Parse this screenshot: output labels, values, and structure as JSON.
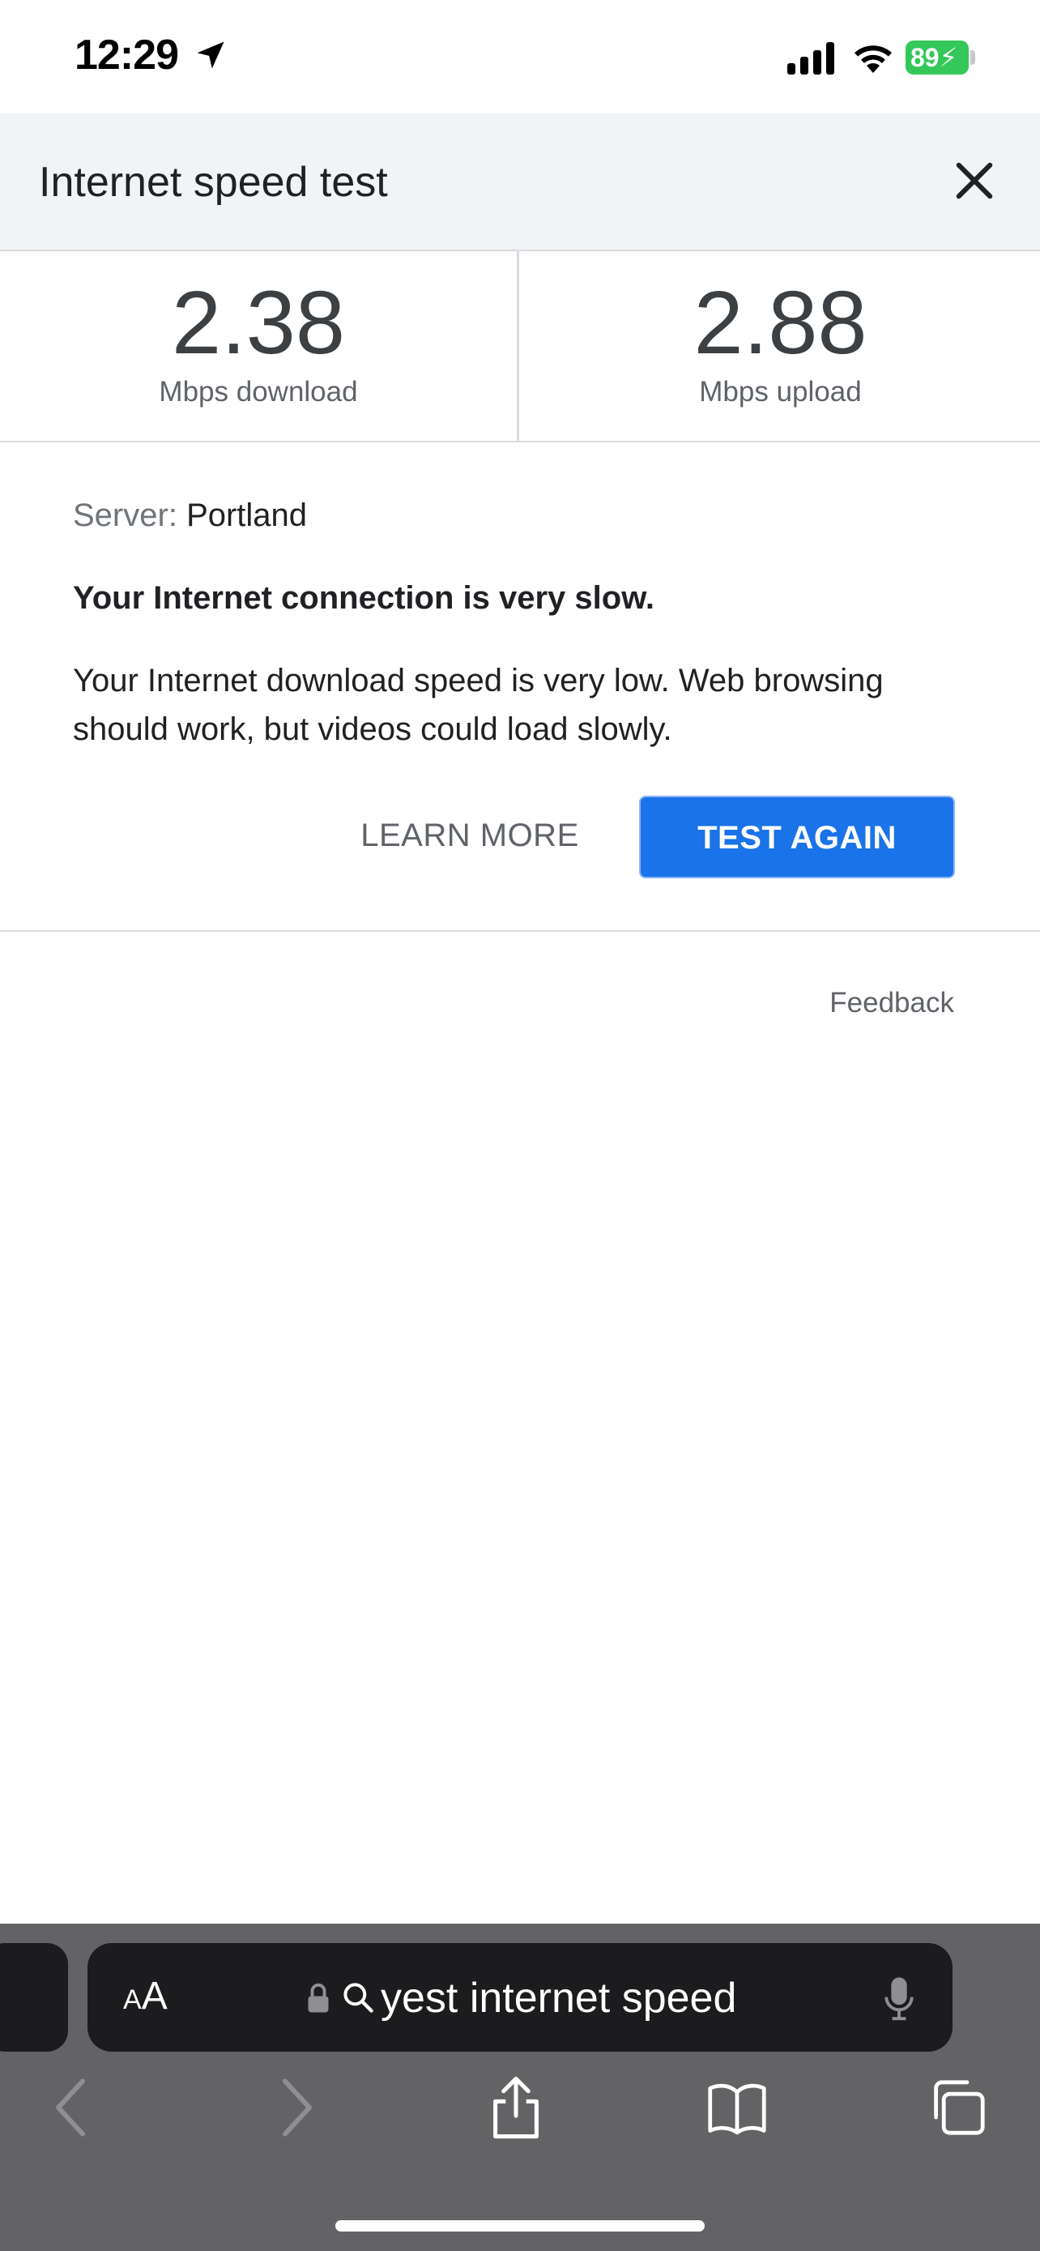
{
  "status_bar": {
    "time": "12:29",
    "battery": "89",
    "icons": [
      "location-arrow-icon",
      "cellular-signal-icon",
      "wifi-icon",
      "battery-icon"
    ]
  },
  "header": {
    "title": "Internet speed test",
    "close_icon": "close-icon"
  },
  "results": {
    "download": {
      "value": "2.38",
      "label": "Mbps download"
    },
    "upload": {
      "value": "2.88",
      "label": "Mbps upload"
    }
  },
  "details": {
    "server_label": "Server:",
    "server_value": "Portland",
    "verdict": "Your Internet connection is very slow.",
    "explanation": "Your Internet download speed is very low. Web browsing should work, but videos could load slowly.",
    "learn_more": "LEARN MORE",
    "test_again": "TEST AGAIN"
  },
  "feedback": "Feedback",
  "colors": {
    "accent": "#1a73e8",
    "battery": "#34c759",
    "safari_bar": "#636366"
  },
  "safari": {
    "aa_small": "A",
    "aa_large": "A",
    "url_text": "yest internet speed",
    "toolbar_icons": [
      "back-icon",
      "forward-icon",
      "share-icon",
      "bookmarks-icon",
      "tabs-icon"
    ]
  }
}
